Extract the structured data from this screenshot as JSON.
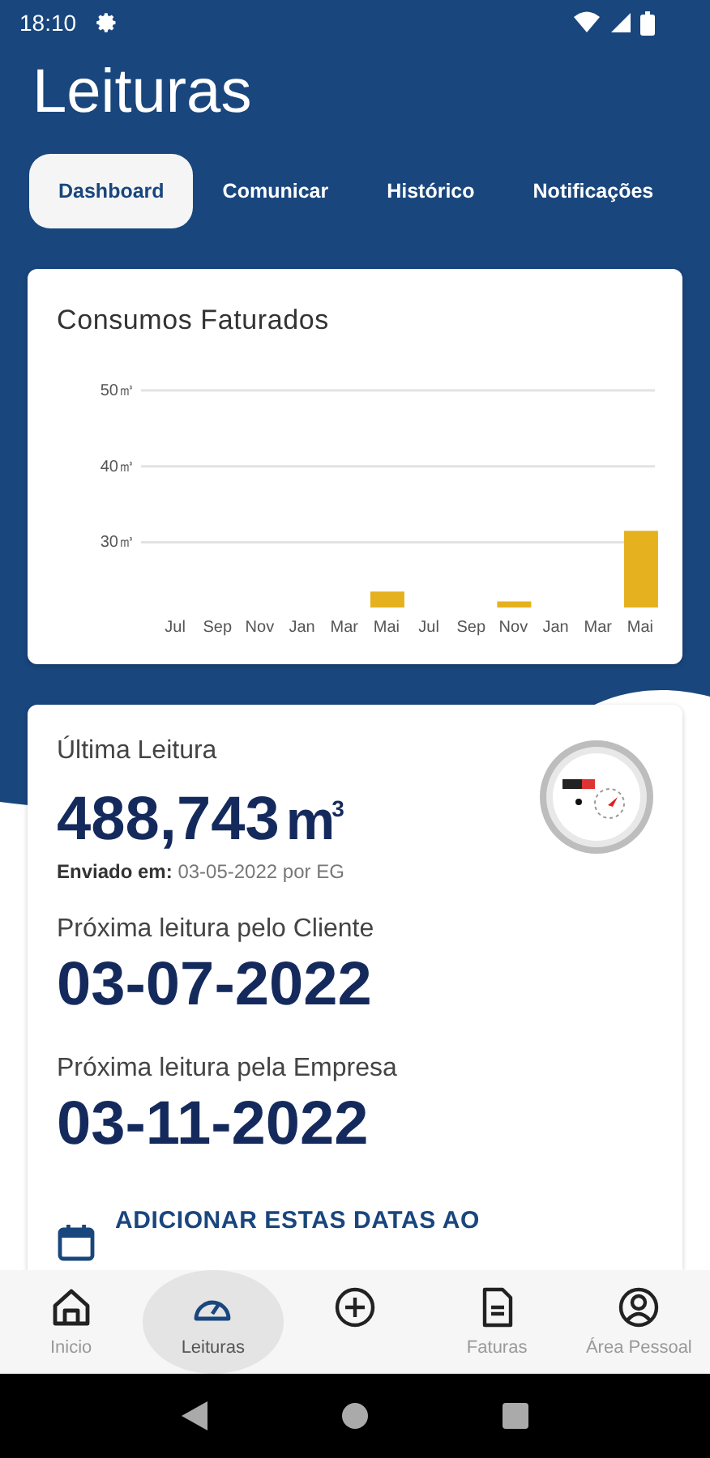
{
  "status_bar": {
    "time": "18:10"
  },
  "title": "Leituras",
  "tabs": [
    {
      "label": "Dashboard",
      "selected": true
    },
    {
      "label": "Comunicar",
      "selected": false
    },
    {
      "label": "Histórico",
      "selected": false
    },
    {
      "label": "Notificações",
      "selected": false
    }
  ],
  "chart_card": {
    "title": "Consumos Faturados",
    "chart_data": {
      "type": "bar",
      "categories": [
        "Jul",
        "Sep",
        "Nov",
        "Jan",
        "Mar",
        "Mai",
        "Jul",
        "Sep",
        "Nov",
        "Jan",
        "Mar",
        "Mai"
      ],
      "series": [
        {
          "color": "#e6b11e",
          "values": [
            null,
            null,
            null,
            null,
            null,
            23.5,
            null,
            null,
            22.2,
            null,
            null,
            31.5
          ]
        }
      ],
      "ylim": [
        21.4,
        50
      ],
      "grid": true,
      "yticks": [
        {
          "value": 30,
          "label": "30㎥"
        },
        {
          "value": 40,
          "label": "40㎥"
        },
        {
          "value": 50,
          "label": "50㎥"
        }
      ]
    }
  },
  "reading_card": {
    "last_label": "Última Leitura",
    "last_value": "488,743",
    "last_unit": "m$^{3}$",
    "sent_label": "Enviado em:",
    "sent_value": "03-05-2022 por EG",
    "next_client_label": "Próxima leitura pelo Cliente",
    "next_client_date": "03-07-2022",
    "next_company_label": "Próxima leitura pela Empresa",
    "next_company_date": "03-11-2022",
    "calendar_action": "ADICIONAR ESTAS DATAS AO"
  },
  "bottom_nav": [
    {
      "kind": "home",
      "label": "Inicio",
      "selected": false
    },
    {
      "kind": "gauge",
      "label": "Leituras",
      "selected": true
    },
    {
      "kind": "add",
      "selected": false
    },
    {
      "kind": "document",
      "label": "Faturas",
      "selected": false
    },
    {
      "kind": "person",
      "label": "Área Pessoal",
      "selected": false
    }
  ]
}
